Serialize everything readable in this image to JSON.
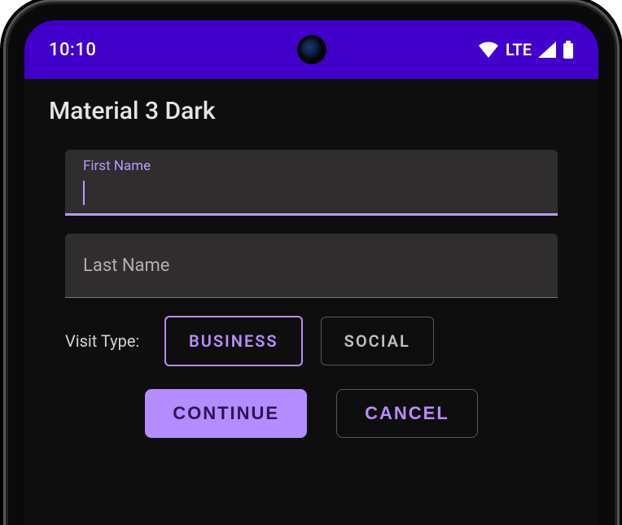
{
  "status": {
    "time": "10:10",
    "network": "LTE"
  },
  "app": {
    "title": "Material 3 Dark"
  },
  "form": {
    "first_name_label": "First Name",
    "first_name_value": "",
    "last_name_label": "Last Name",
    "last_name_value": "",
    "visit_type_label": "Visit Type:",
    "visit_type_options": {
      "business": "BUSINESS",
      "social": "SOCIAL"
    },
    "visit_type_selected": "business"
  },
  "actions": {
    "continue_label": "CONTINUE",
    "cancel_label": "CANCEL"
  },
  "colors": {
    "accent": "#b58cff",
    "statusbar": "#4200cc",
    "surface": "#2f2d2d",
    "background": "#0e0e0e"
  }
}
